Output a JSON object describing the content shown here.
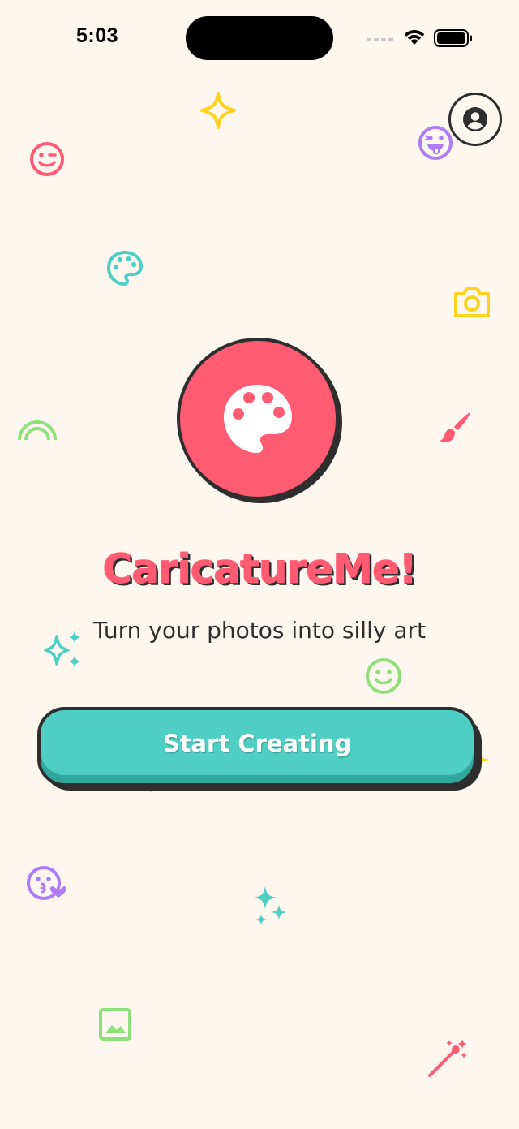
{
  "status_bar": {
    "time": "5:03"
  },
  "profile": {
    "icon": "account-circle-icon"
  },
  "logo": {
    "icon": "palette-icon",
    "color": "#FF5C74"
  },
  "title": "CaricatureMe!",
  "subtitle": "Turn your photos into silly art",
  "cta": {
    "label": "Start Creating",
    "color": "#4FCFC3"
  },
  "decorations": [
    "sparkle-icon",
    "wink-face-icon",
    "tongue-face-icon",
    "palette-icon",
    "camera-icon",
    "rainbow-icon",
    "paintbrush-icon",
    "sparkles-icon",
    "smile-face-icon",
    "kiss-face-icon",
    "sparkles-icon",
    "image-icon",
    "magic-wand-icon"
  ],
  "colors": {
    "background": "#FDF7F0",
    "pink": "#FF5C74",
    "teal": "#4FCFC3",
    "yellow": "#FFD21F",
    "purple": "#B07CF5",
    "green": "#8EE07A",
    "outline": "#2E2E2E"
  }
}
